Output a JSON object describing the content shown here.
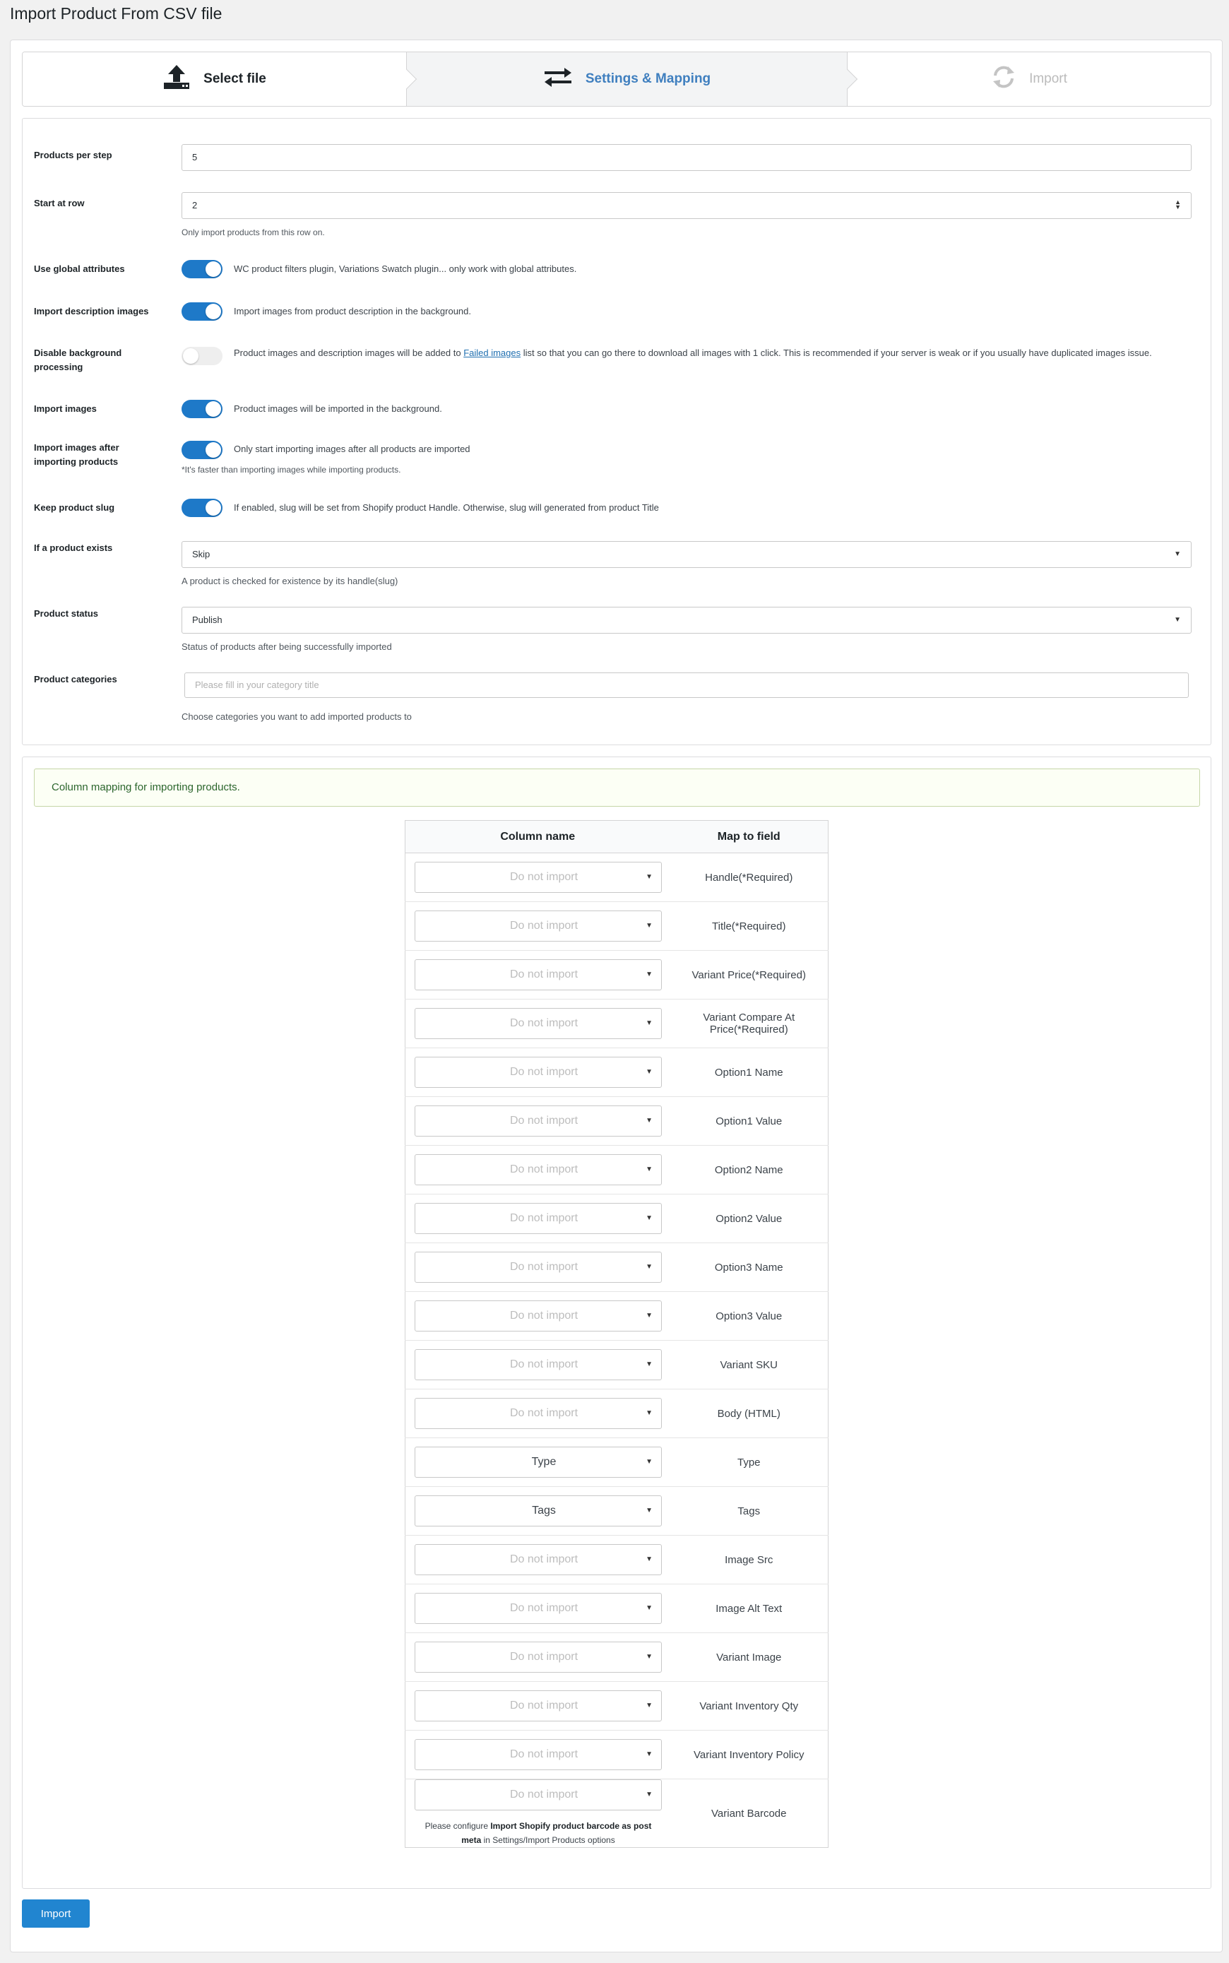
{
  "page_title": "Import Product From CSV file",
  "steps": [
    {
      "label": "Select file",
      "icon": "upload-icon"
    },
    {
      "label": "Settings & Mapping",
      "icon": "exchange-icon"
    },
    {
      "label": "Import",
      "icon": "refresh-icon"
    }
  ],
  "settings": {
    "products_per_step": {
      "label": "Products per step",
      "value": "5"
    },
    "start_at_row": {
      "label": "Start at row",
      "value": "2",
      "desc": "Only import products from this row on."
    },
    "use_global_attributes": {
      "label": "Use global attributes",
      "on": true,
      "desc": "WC product filters plugin, Variations Swatch plugin... only work with global attributes."
    },
    "import_description_images": {
      "label": "Import description images",
      "on": true,
      "desc": "Import images from product description in the background."
    },
    "disable_background_processing": {
      "label": "Disable background processing",
      "on": false,
      "desc_before": "Product images and description images will be added to ",
      "link": "Failed images",
      "desc_after": " list so that you can go there to download all images with 1 click. This is recommended if your server is weak or if you usually have duplicated images issue."
    },
    "import_images": {
      "label": "Import images",
      "on": true,
      "desc": "Product images will be imported in the background."
    },
    "import_images_after": {
      "label": "Import images after importing products",
      "on": true,
      "desc": "Only start importing images after all products are imported",
      "note": "*It's faster than importing images while importing products."
    },
    "keep_product_slug": {
      "label": "Keep product slug",
      "on": true,
      "desc": "If enabled, slug will be set from Shopify product Handle. Otherwise, slug will generated from product Title"
    },
    "if_product_exists": {
      "label": "If a product exists",
      "value": "Skip",
      "desc": "A product is checked for existence by its handle(slug)"
    },
    "product_status": {
      "label": "Product status",
      "value": "Publish",
      "desc": "Status of products after being successfully imported"
    },
    "product_categories": {
      "label": "Product categories",
      "placeholder": "Please fill in your category title",
      "desc": "Choose categories you want to add imported products to"
    }
  },
  "mapping": {
    "message": "Column mapping for importing products.",
    "col_name_header": "Column name",
    "map_to_header": "Map to field",
    "rows": [
      {
        "select": "Do not import",
        "field": "Handle(*Required)"
      },
      {
        "select": "Do not import",
        "field": "Title(*Required)"
      },
      {
        "select": "Do not import",
        "field": "Variant Price(*Required)"
      },
      {
        "select": "Do not import",
        "field": "Variant Compare At Price(*Required)"
      },
      {
        "select": "Do not import",
        "field": "Option1 Name"
      },
      {
        "select": "Do not import",
        "field": "Option1 Value"
      },
      {
        "select": "Do not import",
        "field": "Option2 Name"
      },
      {
        "select": "Do not import",
        "field": "Option2 Value"
      },
      {
        "select": "Do not import",
        "field": "Option3 Name"
      },
      {
        "select": "Do not import",
        "field": "Option3 Value"
      },
      {
        "select": "Do not import",
        "field": "Variant SKU"
      },
      {
        "select": "Do not import",
        "field": "Body (HTML)"
      },
      {
        "select": "Type",
        "field": "Type"
      },
      {
        "select": "Tags",
        "field": "Tags"
      },
      {
        "select": "Do not import",
        "field": "Image Src"
      },
      {
        "select": "Do not import",
        "field": "Image Alt Text"
      },
      {
        "select": "Do not import",
        "field": "Variant Image"
      },
      {
        "select": "Do not import",
        "field": "Variant Inventory Qty"
      },
      {
        "select": "Do not import",
        "field": "Variant Inventory Policy"
      },
      {
        "select": "Do not import",
        "field": "Variant Barcode"
      }
    ],
    "barcode_note": {
      "before": "Please configure ",
      "bold": "Import Shopify product barcode as post meta",
      "after": " in Settings/Import Products options"
    }
  },
  "import_button": "Import",
  "colors": {
    "accent": "#2185d0",
    "toggle_on": "#1e79c8",
    "step_active_text": "#3f7fbf",
    "message_bg": "#fcfff5"
  }
}
